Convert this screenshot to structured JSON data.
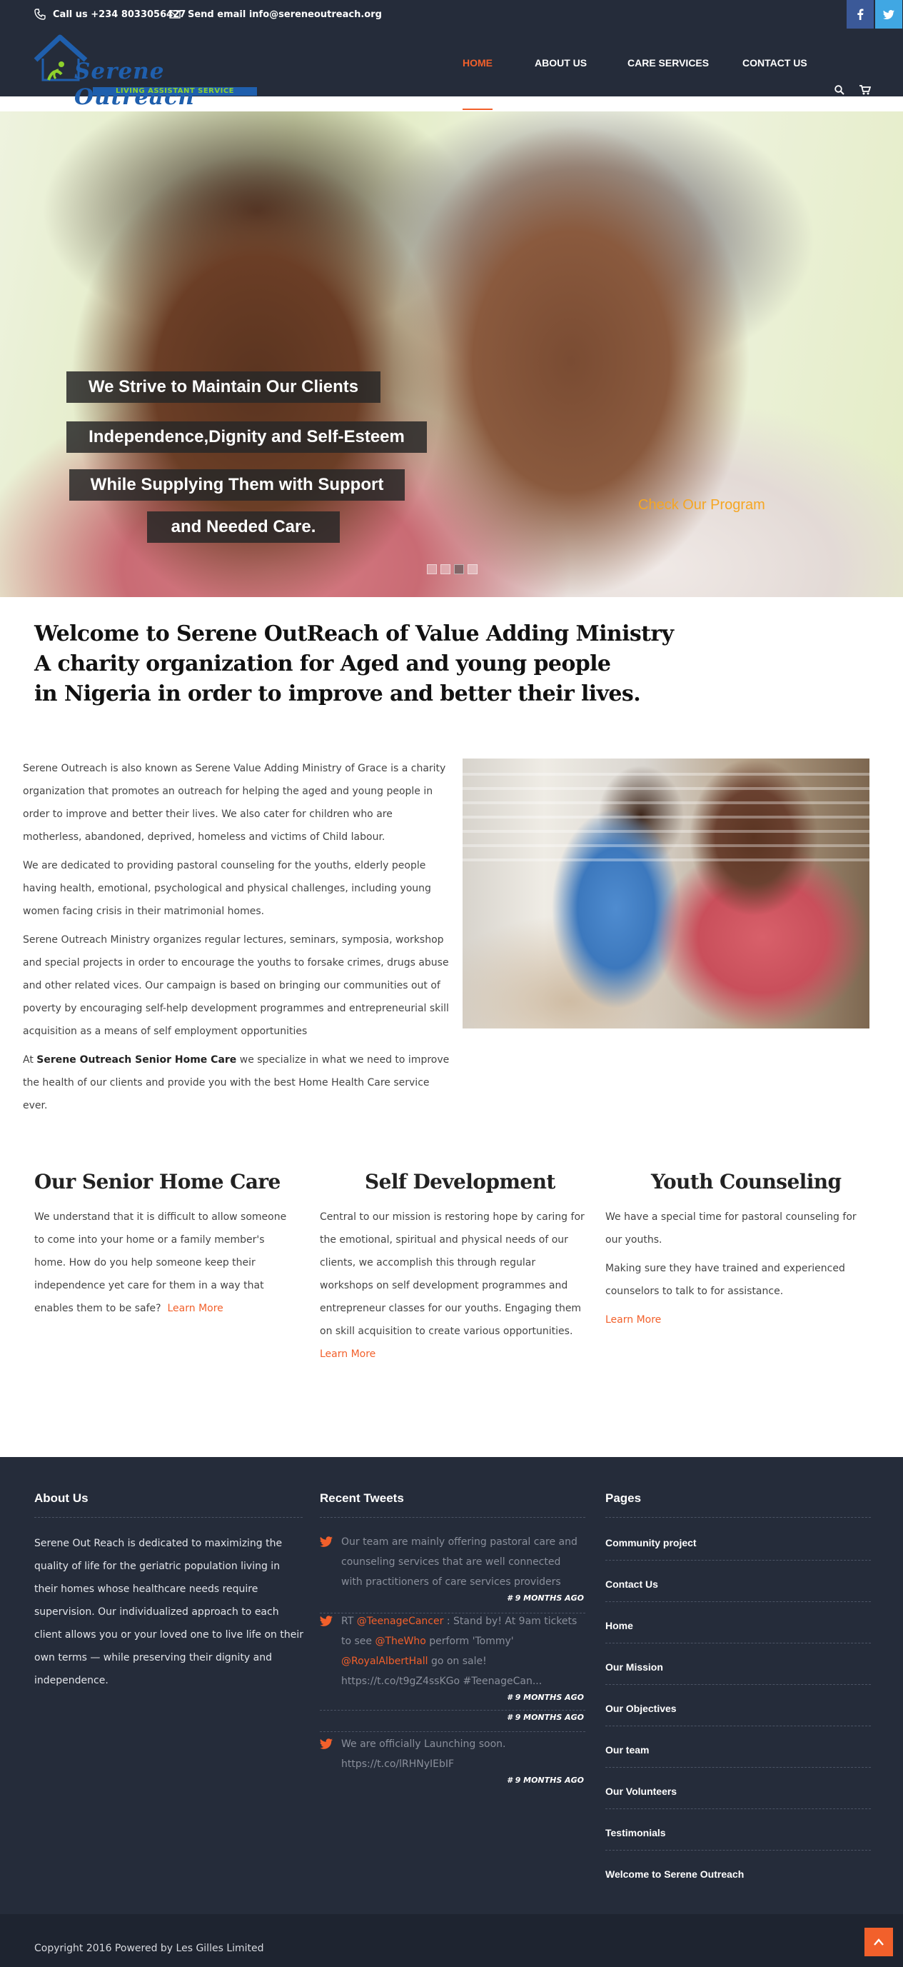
{
  "topbar": {
    "phone_label": "Call us +234 8033056427",
    "email_label": "Send email info@sereneoutreach.org",
    "facebook_icon": "facebook-icon",
    "twitter_icon": "twitter-icon"
  },
  "logo": {
    "name": "Serene Outreach",
    "tagline": "LIVING ASSISTANT SERVICE"
  },
  "nav": {
    "items": [
      "HOME",
      "ABOUT US",
      "CARE SERVICES",
      "CONTACT US"
    ],
    "active": "HOME",
    "search_icon": "search-icon",
    "cart_icon": "cart-icon"
  },
  "hero": {
    "lines": [
      "We Strive to Maintain Our Clients",
      "Independence,Dignity and Self-Esteem",
      "While Supplying Them with Support",
      "and Needed Care."
    ],
    "cta": "Check Our Program",
    "slide_count": 4,
    "active_slide": 3
  },
  "welcome": {
    "lines": [
      "Welcome to Serene OutReach of Value Adding Ministry",
      "A charity organization for Aged and young people",
      "in Nigeria in order to improve and better their lives."
    ]
  },
  "intro": {
    "p1": "Serene Outreach is also known as Serene Value Adding Ministry of Grace is a charity organization that promotes an outreach for helping the aged and young people in order to improve and better their lives. We also cater for children who are motherless, abandoned, deprived, homeless and victims of Child labour.",
    "p2": "We are dedicated to providing pastoral counseling for the youths, elderly people having health, emotional, psychological and physical challenges, including young women facing crisis in their matrimonial homes.",
    "p3": "Serene Outreach Ministry organizes regular lectures, seminars, symposia, workshop and special projects in order to encourage the youths to forsake crimes, drugs abuse and other related vices. Our campaign is based on bringing our communities out of poverty by encouraging self-help development programmes and entrepreneurial skill acquisition as a means of self employment opportunities",
    "p4_prefix": "At ",
    "p4_bold": "Serene Outreach Senior Home Care",
    "p4_suffix": " we specialize in what we need to improve the health of our clients and provide you with the best Home Health Care service ever."
  },
  "services": [
    {
      "title": "Our Senior Home Care",
      "text": "We understand that it is difficult to allow someone to come into your home or a family member's home.  How do you help someone keep their independence yet care for them in a way that enables them to be safe?",
      "link": "Learn More"
    },
    {
      "title": "Self Development",
      "text": "Central to our mission is restoring hope by caring for the emotional, spiritual and physical needs of our clients, we accomplish this through regular workshops on self development programmes and entrepreneur classes for our youths. Engaging them on skill acquisition to create various opportunities.",
      "link": "Learn More"
    },
    {
      "title": "Youth Counseling",
      "p1": "We have a special time for pastoral counseling for our youths.",
      "p2": "Making sure they have trained and experienced counselors to talk to for assistance.",
      "link": "Learn More"
    }
  ],
  "footer": {
    "about_heading": "About Us",
    "about_text": "Serene Out Reach is dedicated to maximizing the quality of life for the geriatric population living in their homes whose healthcare needs require supervision. Our individualized approach to each client allows you or your loved one to live life on their own terms — while preserving their dignity and independence.",
    "tweets_heading": "Recent Tweets",
    "tweets": [
      {
        "text": "Our team are mainly offering pastoral care and counseling services that are well connected with practitioners of care services providers",
        "ago": "# 9 MONTHS AGO"
      },
      {
        "rt": "RT",
        "m1": "@TeenageCancer",
        "t1": " : Stand by! At 9am tickets to see ",
        "m2": "@TheWho",
        "t2": " perform 'Tommy' ",
        "m3": "@RoyalAlbertHall",
        "t3": " go on sale! https://t.co/t9gZ4ssKGo #TeenageCan...",
        "ago": "# 9 MONTHS AGO",
        "ago2": "# 9 MONTHS AGO"
      },
      {
        "text": "We are officially Launching soon. https://t.co/lRHNyIEbIF",
        "ago": "# 9 MONTHS AGO"
      }
    ],
    "pages_heading": "Pages",
    "pages": [
      "Community project",
      "Contact Us",
      "Home",
      "Our Mission",
      "Our Objectives",
      "Our team",
      "Our Volunteers",
      "Testimonials",
      "Welcome to Serene Outreach"
    ],
    "copyright": "Copyright 2016 Powered by Les Gilles Limited",
    "to_top_icon": "arrow-up-icon"
  },
  "colors": {
    "header_bg": "#252c3a",
    "accent": "#f2602b",
    "cta": "#f5a623",
    "logo_blue": "#1f5fad",
    "logo_green": "#8ed12c"
  }
}
